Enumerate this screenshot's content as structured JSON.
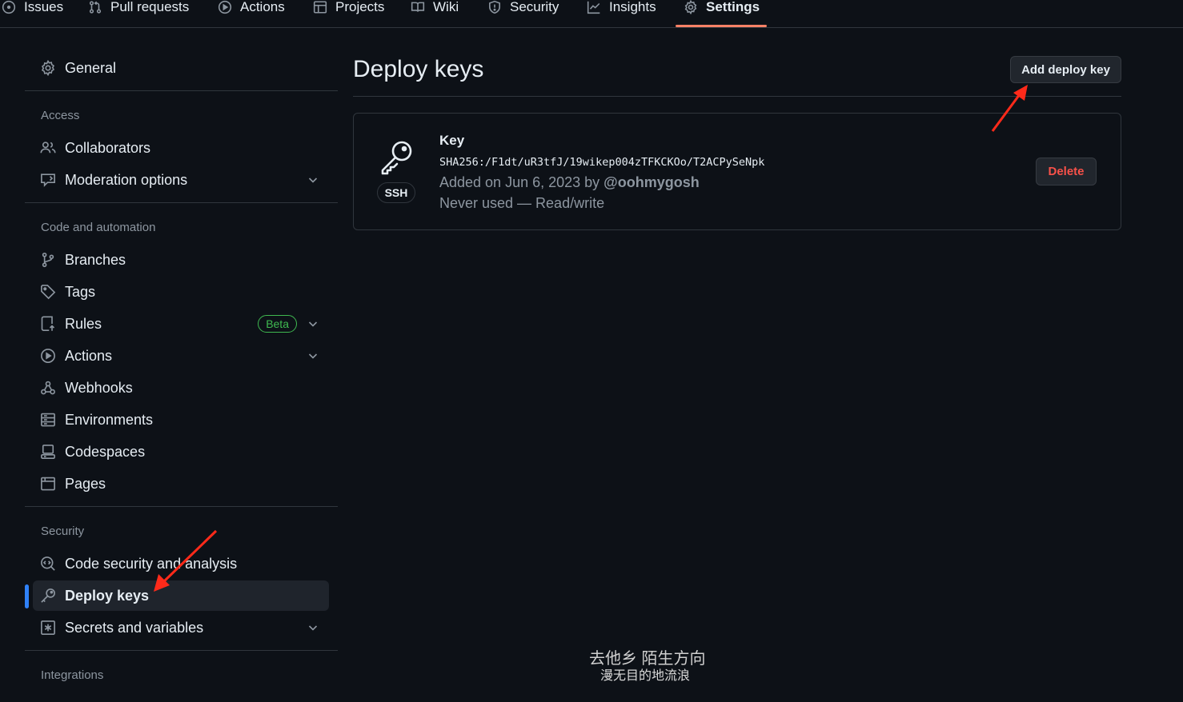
{
  "nav": {
    "tabs": [
      {
        "label": "Issues",
        "icon": "issue-icon"
      },
      {
        "label": "Pull requests",
        "icon": "pull-request-icon"
      },
      {
        "label": "Actions",
        "icon": "play-icon"
      },
      {
        "label": "Projects",
        "icon": "table-icon"
      },
      {
        "label": "Wiki",
        "icon": "book-icon"
      },
      {
        "label": "Security",
        "icon": "shield-icon"
      },
      {
        "label": "Insights",
        "icon": "graph-icon"
      },
      {
        "label": "Settings",
        "icon": "gear-icon",
        "selected": true
      }
    ],
    "underline_color": "#f78166"
  },
  "sidebar": {
    "general": "General",
    "headings": {
      "access": "Access",
      "code_automation": "Code and automation",
      "security": "Security",
      "integrations": "Integrations"
    },
    "items": {
      "collaborators": "Collaborators",
      "moderation": "Moderation options",
      "branches": "Branches",
      "tags": "Tags",
      "rules": "Rules",
      "rules_badge": "Beta",
      "actions": "Actions",
      "webhooks": "Webhooks",
      "environments": "Environments",
      "codespaces": "Codespaces",
      "pages": "Pages",
      "code_security": "Code security and analysis",
      "deploy_keys": "Deploy keys",
      "secrets": "Secrets and variables"
    },
    "active_item": "Deploy keys",
    "active_color": "#2f81f7"
  },
  "main": {
    "title": "Deploy keys",
    "add_button": "Add deploy key",
    "key": {
      "type_badge": "SSH",
      "title": "Key",
      "fingerprint": "SHA256:/F1dt/uR3tfJ/19wikep004zTFKCKOo/T2ACPySeNpk",
      "added_prefix": "Added on Jun 6, 2023 by ",
      "added_user": "@oohmygosh",
      "usage": "Never used — Read/write",
      "delete_button": "Delete"
    }
  },
  "annotations": {
    "arrow_color": "#ff2a1a"
  },
  "watermark": {
    "line1": "去他乡 陌生方向",
    "line2": "漫无目的地流浪"
  }
}
